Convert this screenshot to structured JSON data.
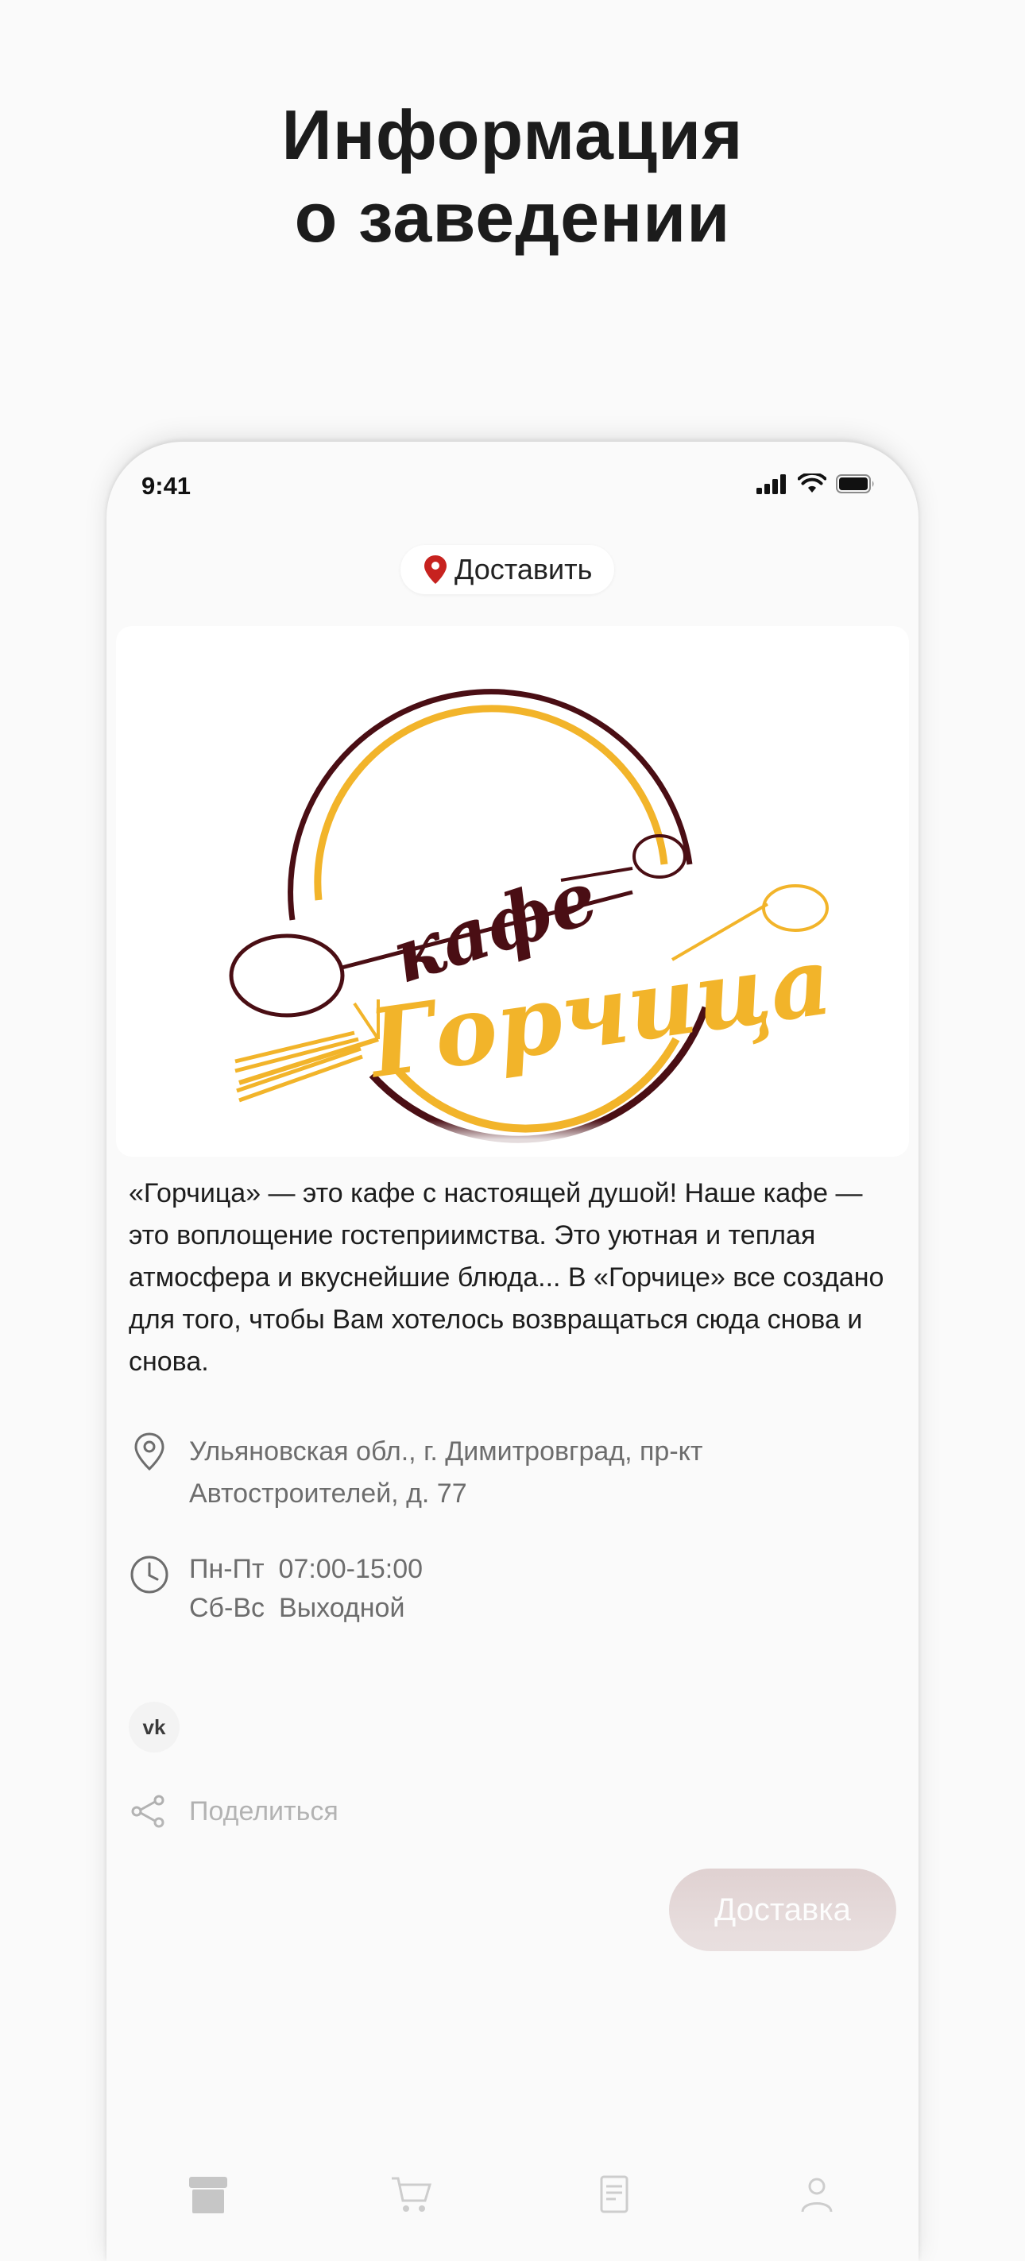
{
  "headline": {
    "line1": "Информация",
    "line2": "о заведении"
  },
  "status_bar": {
    "time": "9:41"
  },
  "delivery_pill": {
    "label": "Доставить",
    "icon": "location-pin-icon"
  },
  "cafe": {
    "logo_text_top": "кафе",
    "logo_text_main": "Горчица",
    "description": "«Горчица» — это кафе с настоящей душой! Наше кафе — это воплощение гостеприимства. Это уютная и теплая атмосфера и вкуснейшие блюда... В «Горчице» все создано для того, чтобы Вам хотелось возвращаться сюда снова и снова.",
    "address": "Ульяновская обл., г. Димитровград, пр-кт Автостроителей, д. 77",
    "hours": [
      {
        "days": "Пн-Пт",
        "time": "07:00-15:00"
      },
      {
        "days": "Сб-Вс",
        "time": "Выходной"
      }
    ],
    "social": {
      "vk_label": "vk"
    },
    "share_label": "Поделиться"
  },
  "delivery_button": {
    "label": "Доставка"
  },
  "colors": {
    "accent_brown": "#4a0e14",
    "accent_yellow": "#f2b42a",
    "button_bg": "#d2bcbc",
    "pin_red": "#c7221f"
  }
}
